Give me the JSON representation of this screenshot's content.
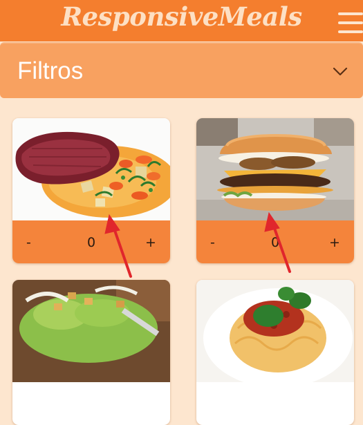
{
  "header": {
    "logo_text": "ResponsiveMeals",
    "menu_icon": "hamburger-menu-icon"
  },
  "filters": {
    "label": "Filtros",
    "toggle_icon": "chevron-down-icon"
  },
  "products": [
    {
      "image": "seared-tuna-steak-with-vegetables",
      "decrement_label": "-",
      "quantity": "0",
      "increment_label": "+"
    },
    {
      "image": "double-cheeseburger",
      "decrement_label": "-",
      "quantity": "0",
      "increment_label": "+"
    },
    {
      "image": "caesar-salad",
      "decrement_label": "-",
      "quantity": "",
      "increment_label": ""
    },
    {
      "image": "spaghetti-bolognese-with-basil",
      "decrement_label": "-",
      "quantity": "",
      "increment_label": ""
    }
  ],
  "colors": {
    "header_bg": "#f47e2e",
    "filter_bg": "#f8a160",
    "page_bg": "#fde6cf",
    "card_controls_bg": "#f4843b",
    "annotation_arrow": "#e0262c"
  }
}
